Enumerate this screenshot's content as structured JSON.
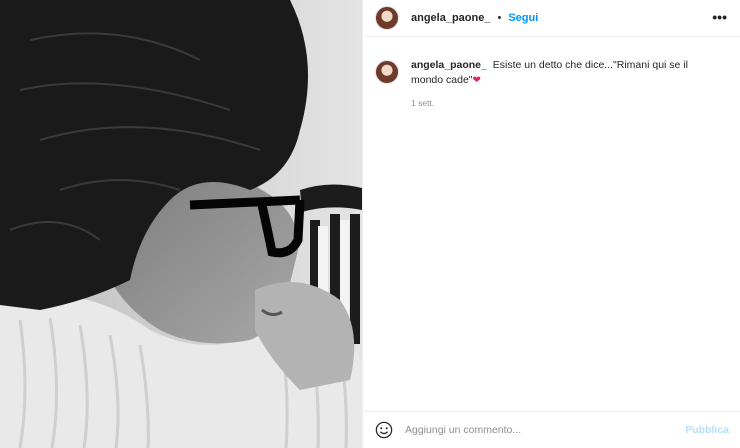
{
  "post": {
    "username": "angela_paone_",
    "separator": "•",
    "follow_label": "Segui",
    "more_label": "•••"
  },
  "caption": {
    "username": "angela_paone_",
    "text": "Esiste un detto che dice...\"Rimani qui se il mondo cade\"",
    "emoji": "❤",
    "timestamp": "1 sett."
  },
  "add_comment": {
    "placeholder": "Aggiungi un commento...",
    "publish_label": "Pubblica"
  },
  "colors": {
    "follow": "#0095f6",
    "publish_disabled": "#b2dffc",
    "heart": "#e0245e"
  },
  "icons": {
    "more": "more-options-icon",
    "emoji": "emoji-icon"
  }
}
